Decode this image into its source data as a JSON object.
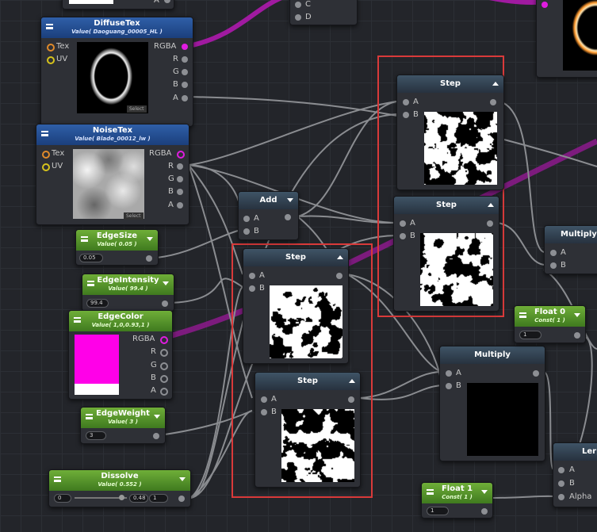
{
  "nodes": {
    "top_partial": {
      "label_a": "A"
    },
    "mux_partial": {
      "ports": [
        "C",
        "D"
      ]
    },
    "diffuse": {
      "title": "DiffuseTex",
      "value": "Value( Daoguang_00005_HL )",
      "in": [
        "Tex",
        "UV"
      ],
      "out": [
        "RGBA",
        "R",
        "G",
        "B",
        "A"
      ],
      "select": "Select"
    },
    "noise": {
      "title": "NoiseTex",
      "value": "Value( Blade_00012_lw )",
      "in": [
        "Tex",
        "UV"
      ],
      "out": [
        "RGBA",
        "R",
        "G",
        "B",
        "A"
      ],
      "select": "Select"
    },
    "edgesize": {
      "title": "EdgeSize",
      "value": "Value( 0.05 )",
      "field": "0.05"
    },
    "edgeintensity": {
      "title": "EdgeIntensity",
      "value": "Value( 99.4 )",
      "field": "99.4"
    },
    "edgecolor": {
      "title": "EdgeColor",
      "value": "Value( 1,0,0.93,1 )",
      "out": [
        "RGBA",
        "R",
        "G",
        "B",
        "A"
      ],
      "swatch": "#ff00e8"
    },
    "edgeweight": {
      "title": "EdgeWeight",
      "value": "Value( 3 )",
      "field": "3"
    },
    "dissolve": {
      "title": "Dissolve",
      "value": "Value( 0.552 )",
      "min": "0",
      "max": "0.48",
      "field": "1",
      "slider_fraction": 0.9
    },
    "add": {
      "title": "Add",
      "in": [
        "A",
        "B"
      ]
    },
    "step1": {
      "title": "Step",
      "in": [
        "A",
        "B"
      ]
    },
    "step2": {
      "title": "Step",
      "in": [
        "A",
        "B"
      ]
    },
    "step3": {
      "title": "Step",
      "in": [
        "A",
        "B"
      ]
    },
    "step4": {
      "title": "Step",
      "in": [
        "A",
        "B"
      ]
    },
    "multiply1": {
      "title": "Multiply",
      "in": [
        "A",
        "B"
      ]
    },
    "multiply2": {
      "title": "Multiply",
      "in": [
        "A",
        "B"
      ]
    },
    "float0": {
      "title": "Float 0",
      "value": "Const( 1 )",
      "field": "1"
    },
    "float1": {
      "title": "Float 1",
      "value": "Const( 1 )",
      "field": "1"
    },
    "lerp": {
      "title": "Lerp",
      "in": [
        "A",
        "B",
        "Alpha"
      ]
    }
  },
  "colors": {
    "wire": "#8a8c90",
    "wire_magenta": "#a01aa0",
    "highlight": "#d93a3a",
    "tex_header": "#2f5fa8",
    "value_header": "#5a9a2e",
    "op_header": "#34475a"
  }
}
